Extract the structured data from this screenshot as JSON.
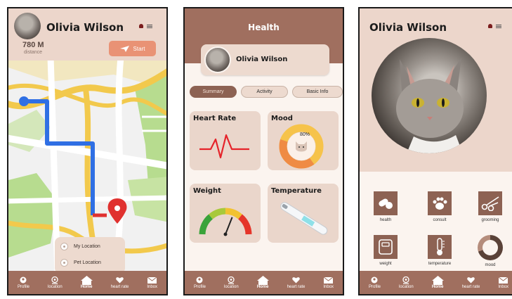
{
  "user": {
    "name": "Olivia Wilson"
  },
  "tracker": {
    "distance_value": "780 M",
    "distance_label": "distance",
    "start_label": "Start"
  },
  "locations": {
    "my": "My Location",
    "pet": "Pet Location"
  },
  "nav": [
    "Profile",
    "location",
    "Home",
    "heart rate",
    "Inbox"
  ],
  "health": {
    "title": "Health",
    "tabs": [
      "Summary",
      "Activity",
      "Basic Info"
    ],
    "cards": {
      "heart_rate": "Heart Rate",
      "mood": "Mood",
      "weight": "Weight",
      "temperature": "Temperature"
    },
    "mood_percent": "80%",
    "mood_level": 0.8,
    "weight_gauge_level": 0.62
  },
  "home_grid": [
    "health",
    "consult",
    "grooming",
    "weight",
    "temperature",
    "mood"
  ],
  "colors": {
    "brown": "#a06f5f",
    "blush": "#ecd6cb",
    "accent": "#e99275"
  }
}
